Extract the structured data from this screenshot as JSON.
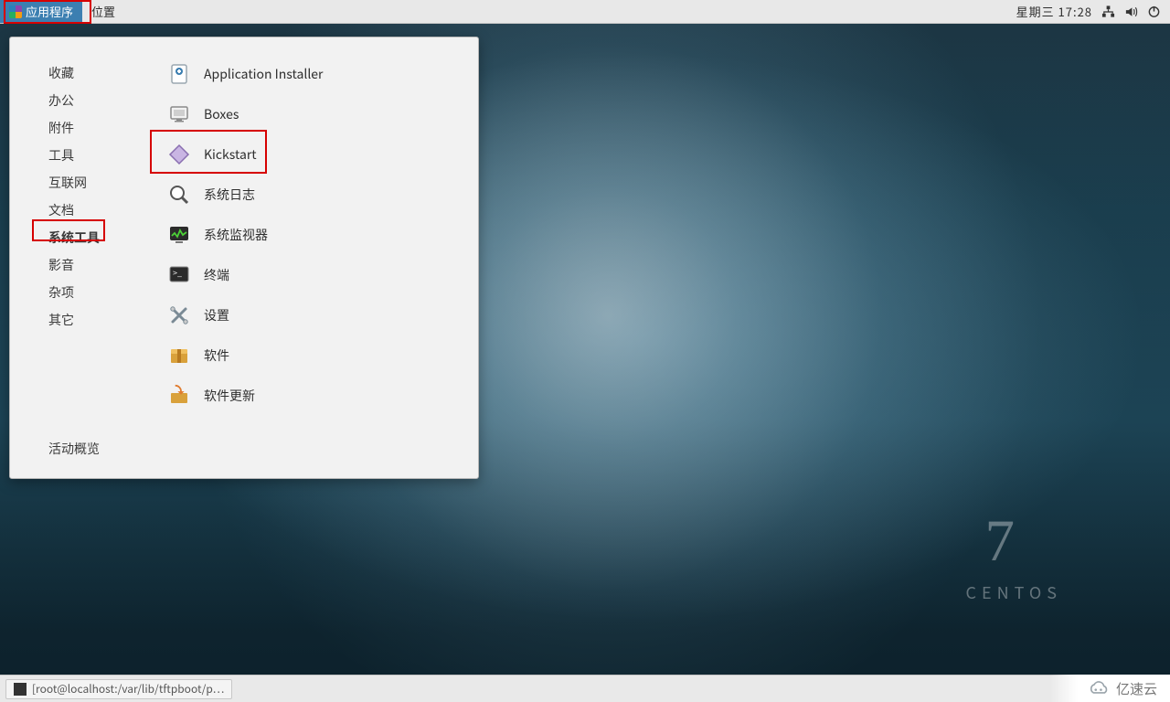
{
  "topbar": {
    "applications": "应用程序",
    "places": "位置",
    "clock": "星期三 17:28"
  },
  "menu": {
    "categories": [
      {
        "label": "收藏",
        "selected": false
      },
      {
        "label": "办公",
        "selected": false
      },
      {
        "label": "附件",
        "selected": false
      },
      {
        "label": "工具",
        "selected": false
      },
      {
        "label": "互联网",
        "selected": false
      },
      {
        "label": "文档",
        "selected": false
      },
      {
        "label": "系统工具",
        "selected": true
      },
      {
        "label": "影音",
        "selected": false
      },
      {
        "label": "杂项",
        "selected": false
      },
      {
        "label": "其它",
        "selected": false
      }
    ],
    "overview": "活动概览",
    "apps": [
      {
        "icon": "application-installer-icon",
        "label": "Application Installer"
      },
      {
        "icon": "boxes-icon",
        "label": "Boxes"
      },
      {
        "icon": "kickstart-icon",
        "label": "Kickstart"
      },
      {
        "icon": "system-log-icon",
        "label": "系统日志"
      },
      {
        "icon": "system-monitor-icon",
        "label": "系统监视器"
      },
      {
        "icon": "terminal-icon",
        "label": "终端"
      },
      {
        "icon": "settings-icon",
        "label": "设置"
      },
      {
        "icon": "software-icon",
        "label": "软件"
      },
      {
        "icon": "software-update-icon",
        "label": "软件更新"
      }
    ]
  },
  "brand": {
    "seven": "7",
    "name": "CENTOS"
  },
  "taskbar": {
    "items": [
      {
        "label": "[root@localhost:/var/lib/tftpboot/p…"
      }
    ]
  },
  "watermark": "亿速云"
}
